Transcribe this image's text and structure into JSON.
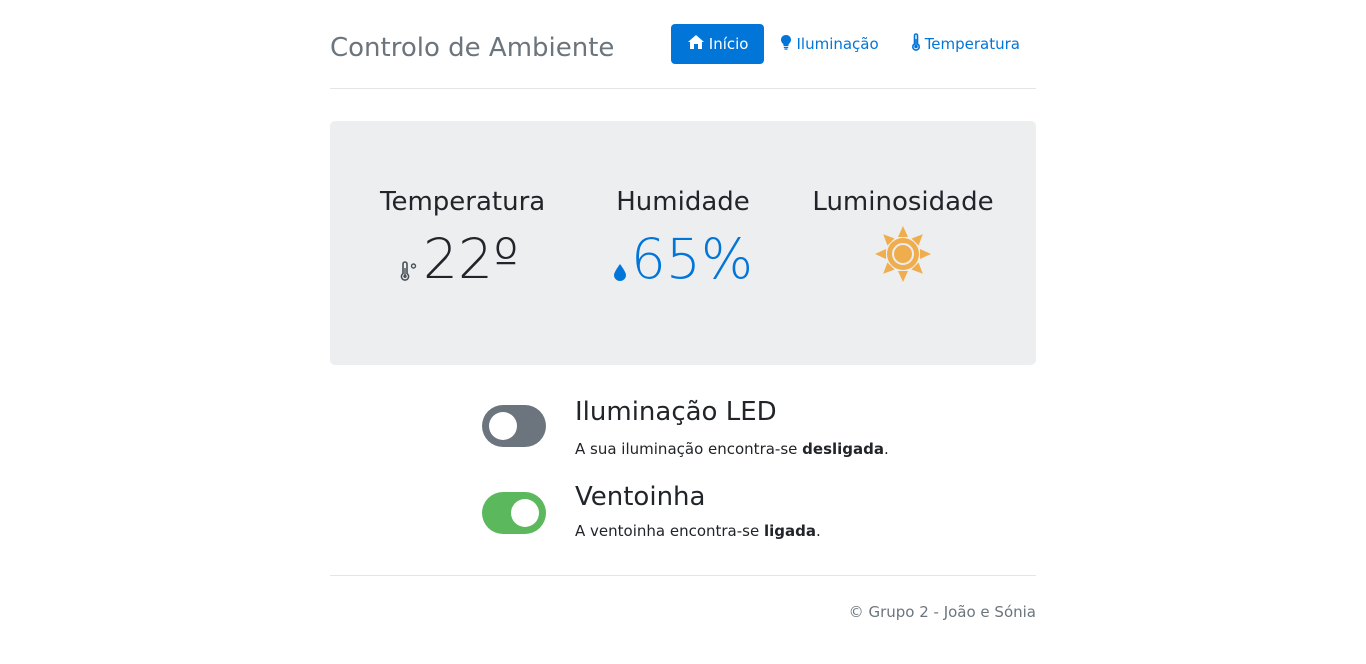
{
  "header": {
    "brand": "Controlo de Ambiente",
    "nav": [
      {
        "label": "Início",
        "icon": "home-icon",
        "active": true
      },
      {
        "label": "Iluminação",
        "icon": "lightbulb-icon",
        "active": false
      },
      {
        "label": "Temperatura",
        "icon": "thermometer-icon",
        "active": false
      }
    ]
  },
  "stats": {
    "temperature": {
      "title": "Temperatura",
      "value": "22º",
      "icon": "thermometer-celsius-icon"
    },
    "humidity": {
      "title": "Humidade",
      "value": "65%",
      "icon": "water-drop-icon"
    },
    "luminosity": {
      "title": "Luminosidade",
      "icon": "sun-icon"
    }
  },
  "devices": {
    "led": {
      "title": "Iluminação LED",
      "desc_prefix": "A sua iluminação encontra-se ",
      "state": "desligada",
      "desc_suffix": ".",
      "on": false
    },
    "fan": {
      "title": "Ventoinha",
      "desc_prefix": "A ventoinha encontra-se ",
      "state": "ligada",
      "desc_suffix": ".",
      "on": true
    }
  },
  "footer": {
    "text": "© Grupo 2 - João e Sónia"
  },
  "colors": {
    "primary": "#0275d8",
    "success": "#5cb85c",
    "secondary": "#6c757d",
    "sun": "#f0ad4e",
    "jumbotron": "#eceef0"
  }
}
